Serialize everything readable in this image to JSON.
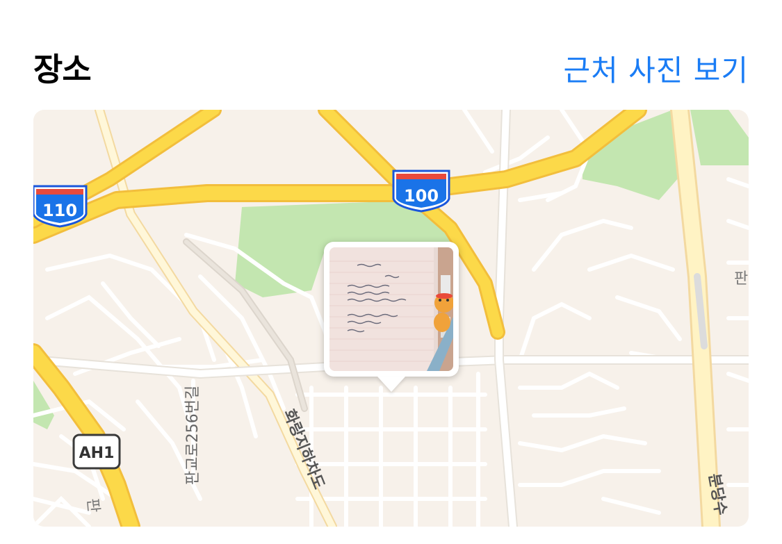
{
  "header": {
    "title": "장소",
    "nearby_link": "근처 사진 보기"
  },
  "map": {
    "shields": {
      "i110": "110",
      "i100": "100",
      "ah1": "AH1"
    },
    "street_labels": {
      "pangyo_256": "판교로256번길",
      "hwarang": "화랑지하차도",
      "bundang": "분당수",
      "pan_right": "판",
      "pan_left": "판"
    },
    "colors": {
      "land": "#f7f1ea",
      "park": "#c3e6b0",
      "highway": "#fcd949",
      "highway_edge": "#f2be3c",
      "street": "#ffffff",
      "link": "#1a7cf5"
    },
    "photo_pin": {
      "icon": "photo-thumbnail"
    }
  }
}
